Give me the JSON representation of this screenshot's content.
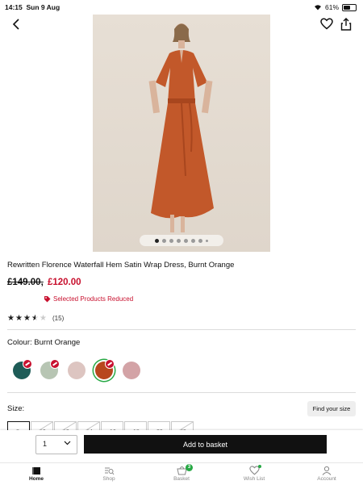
{
  "status": {
    "time": "14:15",
    "date": "Sun 9 Aug",
    "battery": "61%",
    "battery_level": 0.61
  },
  "product": {
    "title": "Rewritten Florence Waterfall Hem Satin Wrap Dress, Burnt Orange",
    "was_price": "£149.00,",
    "now_price": "£120.00",
    "promo": "Selected Products Reduced",
    "rating": 3.5,
    "review_count": "(15)",
    "colour_label": "Colour: Burnt Orange",
    "size_label": "Size:",
    "find_size": "Find your size"
  },
  "gallery": {
    "count": 8,
    "active_index": 0
  },
  "colours": [
    {
      "name": "teal-swatch",
      "color": "#1e5c57",
      "sale": true
    },
    {
      "name": "sage-swatch",
      "color": "#b7c5b3",
      "sale": true
    },
    {
      "name": "blush-swatch",
      "color": "#ddc5c1",
      "sale": false
    },
    {
      "name": "burnt-orange-swatch",
      "color": "#b8471e",
      "sale": true,
      "selected": true
    },
    {
      "name": "rose-swatch",
      "color": "#d3a3a6",
      "sale": false
    }
  ],
  "sizes": [
    "8",
    "10",
    "12",
    "14",
    "16",
    "18",
    "20",
    "22"
  ],
  "basket": {
    "quantity": "1",
    "add_label": "Add to basket"
  },
  "tabs": [
    {
      "label": "Home",
      "icon": "home-icon",
      "active": true
    },
    {
      "label": "Shop",
      "icon": "shop-search-icon"
    },
    {
      "label": "Basket",
      "icon": "basket-icon",
      "count": "3"
    },
    {
      "label": "Wish List",
      "icon": "heart-icon"
    },
    {
      "label": "Account",
      "icon": "account-icon"
    }
  ],
  "colors": {
    "sale_red": "#c8102e",
    "accent_green": "#27a844",
    "dress": "#c2582a"
  }
}
